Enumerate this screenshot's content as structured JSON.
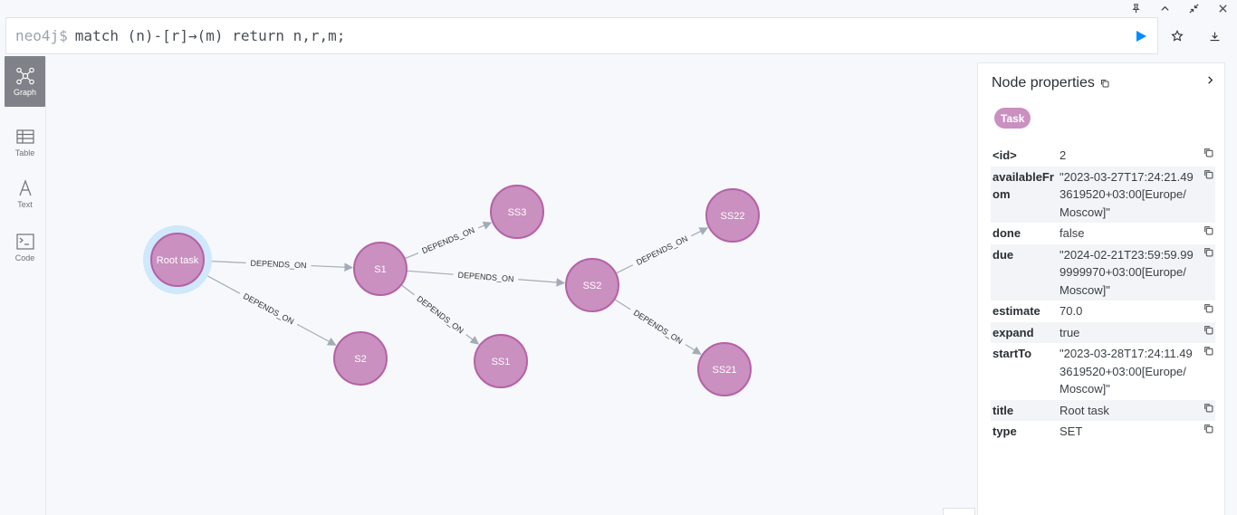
{
  "window": {
    "controls": [
      "pin-icon",
      "chevron-up-icon",
      "minimize-arrows-icon",
      "close-icon"
    ]
  },
  "editor": {
    "prompt": "neo4j$",
    "query": "match (n)-[r]→(m) return n,r,m;"
  },
  "views": [
    {
      "label": "Graph",
      "icon": "graph-icon",
      "active": true
    },
    {
      "label": "Table",
      "icon": "table-icon",
      "active": false
    },
    {
      "label": "Text",
      "icon": "text-icon",
      "active": false
    },
    {
      "label": "Code",
      "icon": "code-icon",
      "active": false
    }
  ],
  "graph": {
    "node_color": "#c990c0",
    "node_stroke": "#b561a7",
    "selected_halo": "#cfe8fb",
    "nodes": [
      {
        "id": "root",
        "label": "Root task",
        "selected": true
      },
      {
        "id": "s1",
        "label": "S1"
      },
      {
        "id": "s2",
        "label": "S2"
      },
      {
        "id": "ss1",
        "label": "SS1"
      },
      {
        "id": "ss2",
        "label": "SS2"
      },
      {
        "id": "ss3",
        "label": "SS3"
      },
      {
        "id": "ss21",
        "label": "SS21"
      },
      {
        "id": "ss22",
        "label": "SS22"
      }
    ],
    "relationships": [
      {
        "from": "root",
        "to": "s1",
        "type": "DEPENDS_ON"
      },
      {
        "from": "root",
        "to": "s2",
        "type": "DEPENDS_ON"
      },
      {
        "from": "s1",
        "to": "ss3",
        "type": "DEPENDS_ON"
      },
      {
        "from": "s1",
        "to": "ss2",
        "type": "DEPENDS_ON"
      },
      {
        "from": "s1",
        "to": "ss1",
        "type": "DEPENDS_ON"
      },
      {
        "from": "ss2",
        "to": "ss22",
        "type": "DEPENDS_ON"
      },
      {
        "from": "ss2",
        "to": "ss21",
        "type": "DEPENDS_ON"
      }
    ]
  },
  "panel": {
    "title": "Node properties",
    "label": "Task",
    "properties": [
      {
        "key": "<id>",
        "value": "2"
      },
      {
        "key": "availableFrom",
        "value": "\"2023-03-27T17:24:21.493619520+03:00[Europe/Moscow]\""
      },
      {
        "key": "done",
        "value": "false"
      },
      {
        "key": "due",
        "value": "\"2024-02-21T23:59:59.999999970+03:00[Europe/Moscow]\""
      },
      {
        "key": "estimate",
        "value": "70.0"
      },
      {
        "key": "expand",
        "value": "true"
      },
      {
        "key": "startTo",
        "value": "\"2023-03-28T17:24:11.493619520+03:00[Europe/Moscow]\""
      },
      {
        "key": "title",
        "value": "Root task"
      },
      {
        "key": "type",
        "value": "SET"
      }
    ]
  }
}
